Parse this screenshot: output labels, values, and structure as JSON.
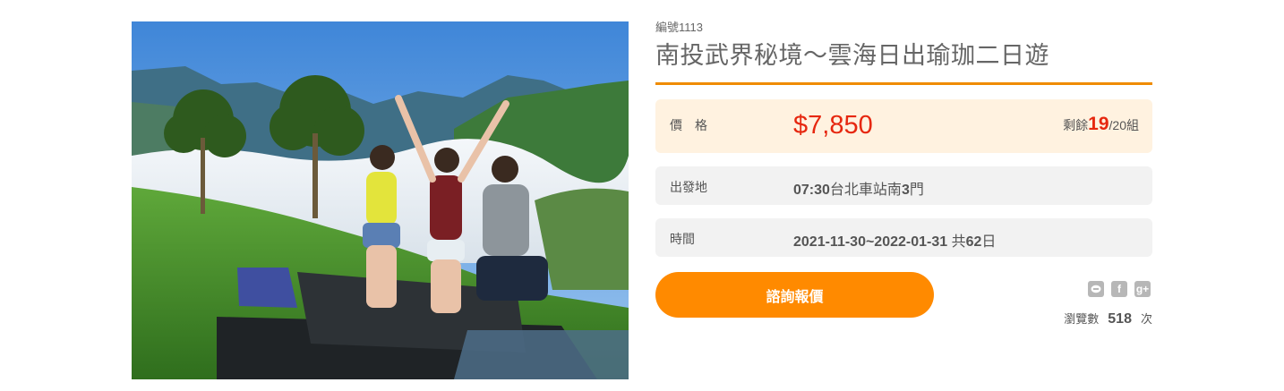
{
  "tour": {
    "code": "編號1113",
    "title": "南投武界秘境～雲海日出瑜珈二日遊"
  },
  "price": {
    "label": "價格",
    "amount": "$7,850",
    "remain_prefix": "剩餘",
    "remain_count": "19",
    "remain_suffix": "/20組"
  },
  "departure": {
    "label": "出發地",
    "time": "07:30",
    "place_text": "台北車站南",
    "gate_number": "3",
    "gate_suffix": "門"
  },
  "period": {
    "label": "時間",
    "range": "2021-11-30~2022-01-31",
    "total_prefix": " 共",
    "days": "62",
    "days_suffix": "日"
  },
  "cta": {
    "label": "諮詢報價"
  },
  "share": {
    "icons": [
      "line-icon",
      "facebook-icon",
      "google-plus-icon"
    ],
    "facebook_glyph": "f",
    "google_glyph": "g+"
  },
  "views": {
    "label": "瀏覽數",
    "count": "518",
    "unit": "次"
  },
  "colors": {
    "accent": "#ff8a00",
    "price": "#e6270f",
    "price_bg": "#fff2e0",
    "row_bg": "#f2f2f2"
  }
}
